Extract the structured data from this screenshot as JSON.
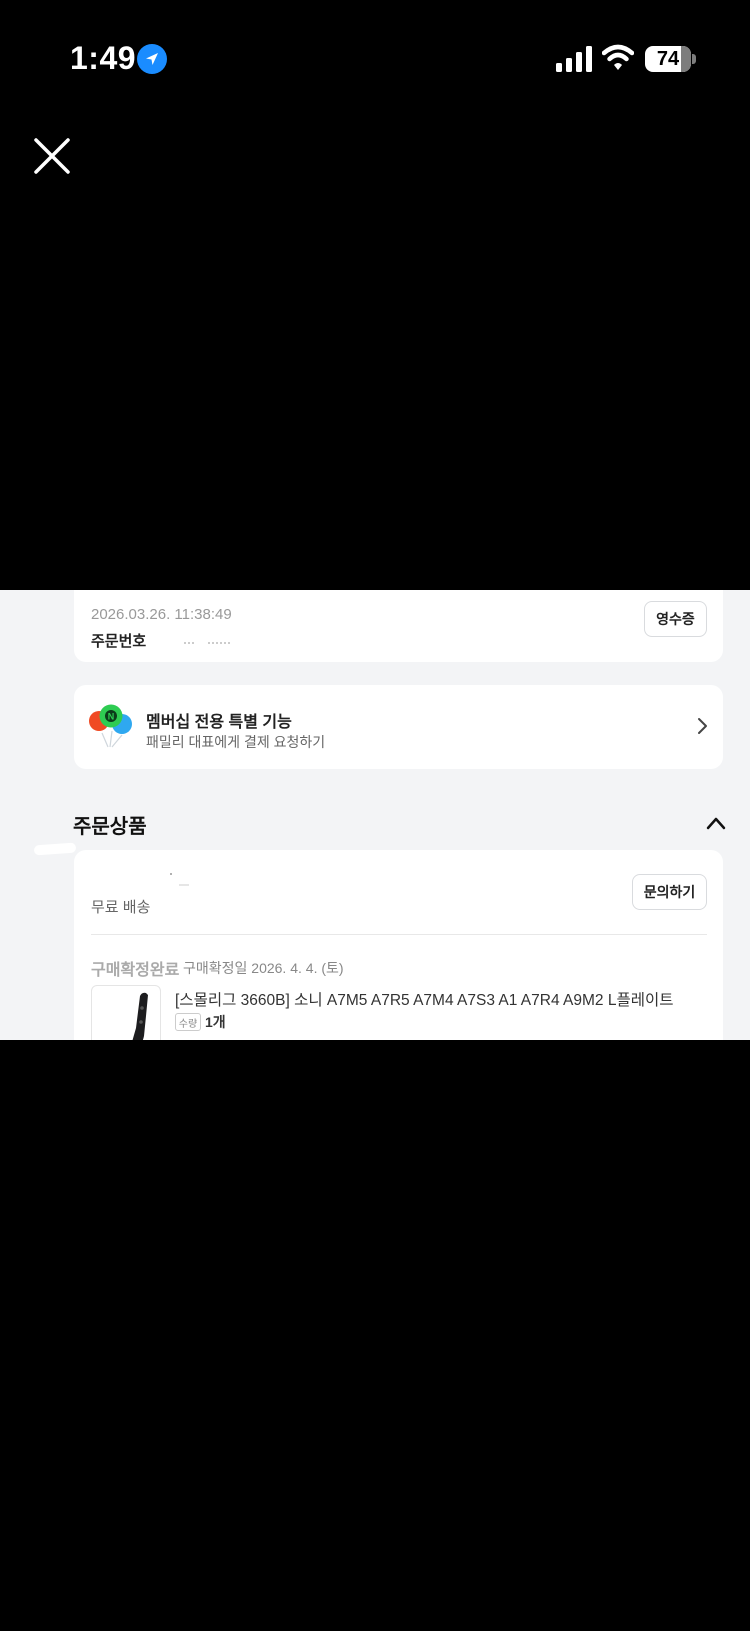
{
  "status_bar": {
    "time": "1:49",
    "battery": "74",
    "icons": [
      "location-arrow-icon",
      "cellular-signal-icon",
      "wifi-icon",
      "battery-icon"
    ]
  },
  "viewer": {
    "close_icon": "close-icon"
  },
  "order": {
    "date": "2026.03.26. 11:38:49",
    "number_label": "주문번호 2(",
    "receipt_label": "영수증"
  },
  "membership": {
    "title": "멤버십 전용 특별 기능",
    "subtitle": "패밀리 대표에게 결제 요청하기",
    "icon": "balloons-icon"
  },
  "section": {
    "title": "주문상품",
    "collapse_icon": "chevron-up-icon"
  },
  "product_card": {
    "shipping": "무료 배송",
    "inquiry_label": "문의하기",
    "status": "구매확정완료",
    "confirm_date": "구매확정일 2026. 4. 4. (토)",
    "product_name": "[스몰리그 3660B] 소니 A7M5 A7R5 A7M4 A7S3 A1 A7R4 A9M2 L플레이트",
    "qty_label": "수량",
    "qty_value": "1개"
  },
  "colors": {
    "background": "#000000",
    "content_bg": "#f3f4f6",
    "card_bg": "#ffffff",
    "location_blue": "#1a8cff",
    "balloon_red": "#f04a24",
    "balloon_green": "#2ecc52",
    "balloon_blue": "#2fa8f0"
  }
}
